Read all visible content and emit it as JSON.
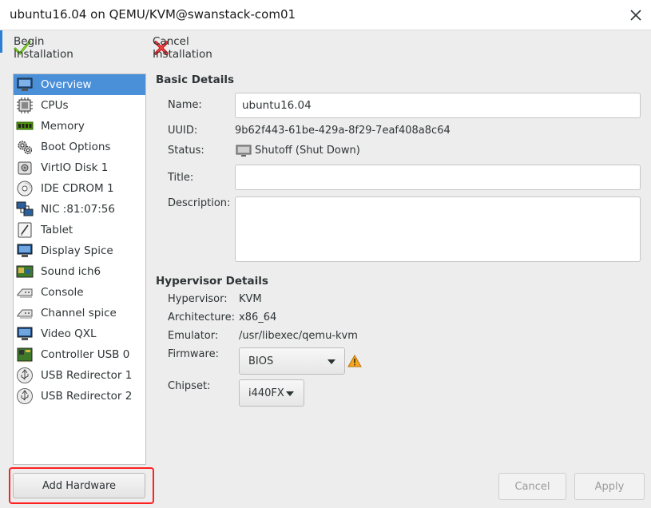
{
  "window": {
    "title": "ubuntu16.04 on QEMU/KVM@swanstack-com01"
  },
  "toolbar": {
    "begin_label": "Begin Installation",
    "cancel_label": "Cancel Installation"
  },
  "sidebar": {
    "items": [
      {
        "label": "Overview",
        "icon": "monitor-icon"
      },
      {
        "label": "CPUs",
        "icon": "cpu-icon"
      },
      {
        "label": "Memory",
        "icon": "memory-icon"
      },
      {
        "label": "Boot Options",
        "icon": "gears-icon"
      },
      {
        "label": "VirtIO Disk 1",
        "icon": "disk-icon"
      },
      {
        "label": "IDE CDROM 1",
        "icon": "cdrom-icon"
      },
      {
        "label": "NIC :81:07:56",
        "icon": "network-icon"
      },
      {
        "label": "Tablet",
        "icon": "tablet-icon"
      },
      {
        "label": "Display Spice",
        "icon": "display-icon"
      },
      {
        "label": "Sound ich6",
        "icon": "sound-icon"
      },
      {
        "label": "Console",
        "icon": "serial-icon"
      },
      {
        "label": "Channel spice",
        "icon": "serial-icon"
      },
      {
        "label": "Video QXL",
        "icon": "video-icon"
      },
      {
        "label": "Controller USB 0",
        "icon": "controller-icon"
      },
      {
        "label": "USB Redirector 1",
        "icon": "usb-icon"
      },
      {
        "label": "USB Redirector 2",
        "icon": "usb-icon"
      }
    ],
    "add_hardware_label": "Add Hardware"
  },
  "basic": {
    "heading": "Basic Details",
    "name_label": "Name:",
    "name_value": "ubuntu16.04",
    "uuid_label": "UUID:",
    "uuid_value": "9b62f443-61be-429a-8f29-7eaf408a8c64",
    "status_label": "Status:",
    "status_value": "Shutoff (Shut Down)",
    "title_label": "Title:",
    "title_value": "",
    "description_label": "Description:",
    "description_value": ""
  },
  "hypervisor": {
    "heading": "Hypervisor Details",
    "hypervisor_label": "Hypervisor:",
    "hypervisor_value": "KVM",
    "architecture_label": "Architecture:",
    "architecture_value": "x86_64",
    "emulator_label": "Emulator:",
    "emulator_value": "/usr/libexec/qemu-kvm",
    "firmware_label": "Firmware:",
    "firmware_value": "BIOS",
    "chipset_label": "Chipset:",
    "chipset_value": "i440FX"
  },
  "footer": {
    "cancel_label": "Cancel",
    "apply_label": "Apply"
  },
  "colors": {
    "selection": "#4a90d9",
    "highlight_box": "#ff2020",
    "warning": "#f5a623"
  }
}
